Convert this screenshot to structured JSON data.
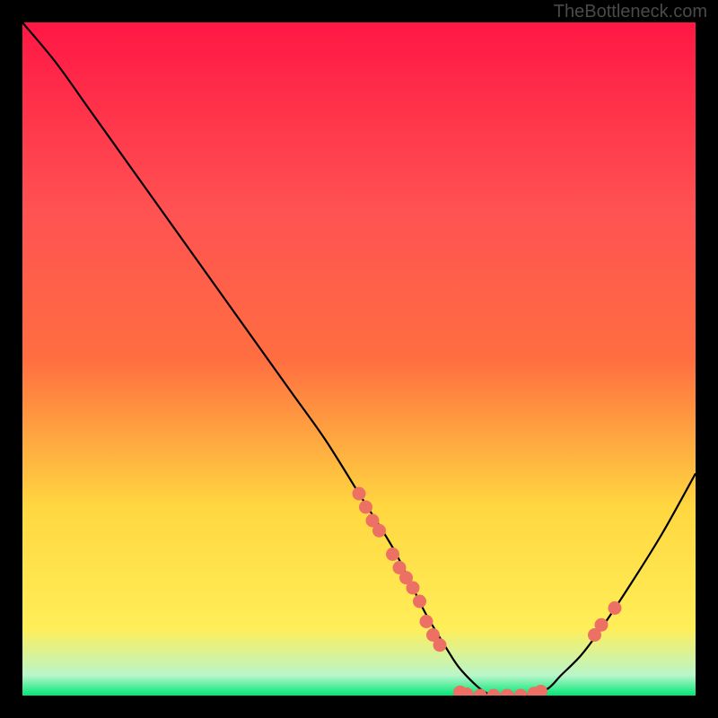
{
  "watermark": "TheBottleneck.com",
  "chart_data": {
    "type": "line",
    "title": "",
    "xlabel": "",
    "ylabel": "",
    "xlim": [
      0,
      100
    ],
    "ylim": [
      0,
      100
    ],
    "gradient_colors": {
      "top": "#ff1744",
      "mid_upper": "#ff6e40",
      "mid": "#ffd740",
      "mid_lower": "#ffee58",
      "bottom": "#00e676"
    },
    "series": [
      {
        "name": "curve",
        "x": [
          0,
          5,
          10,
          15,
          20,
          25,
          30,
          35,
          40,
          45,
          50,
          55,
          58,
          60,
          63,
          65,
          68,
          70,
          72,
          75,
          78,
          80,
          83,
          86,
          90,
          95,
          100
        ],
        "y": [
          100,
          94,
          87,
          80,
          73,
          66,
          59,
          52,
          45,
          38,
          30,
          22,
          16,
          12,
          7,
          4,
          1,
          0,
          0,
          0,
          1,
          3,
          6,
          10,
          16,
          24,
          33
        ]
      }
    ],
    "markers": {
      "name": "data-points",
      "color": "#ec7063",
      "points": [
        {
          "x": 50,
          "y": 30
        },
        {
          "x": 51,
          "y": 28
        },
        {
          "x": 52,
          "y": 26
        },
        {
          "x": 53,
          "y": 24.5
        },
        {
          "x": 55,
          "y": 21
        },
        {
          "x": 56,
          "y": 19
        },
        {
          "x": 57,
          "y": 17.5
        },
        {
          "x": 58,
          "y": 16
        },
        {
          "x": 59,
          "y": 14
        },
        {
          "x": 60,
          "y": 11
        },
        {
          "x": 61,
          "y": 9
        },
        {
          "x": 62,
          "y": 7.5
        },
        {
          "x": 65,
          "y": 0.5
        },
        {
          "x": 66,
          "y": 0.2
        },
        {
          "x": 68,
          "y": 0
        },
        {
          "x": 70,
          "y": 0
        },
        {
          "x": 72,
          "y": 0
        },
        {
          "x": 74,
          "y": 0
        },
        {
          "x": 76,
          "y": 0.3
        },
        {
          "x": 77,
          "y": 0.6
        },
        {
          "x": 85,
          "y": 9
        },
        {
          "x": 86,
          "y": 10.5
        },
        {
          "x": 88,
          "y": 13
        }
      ]
    }
  }
}
